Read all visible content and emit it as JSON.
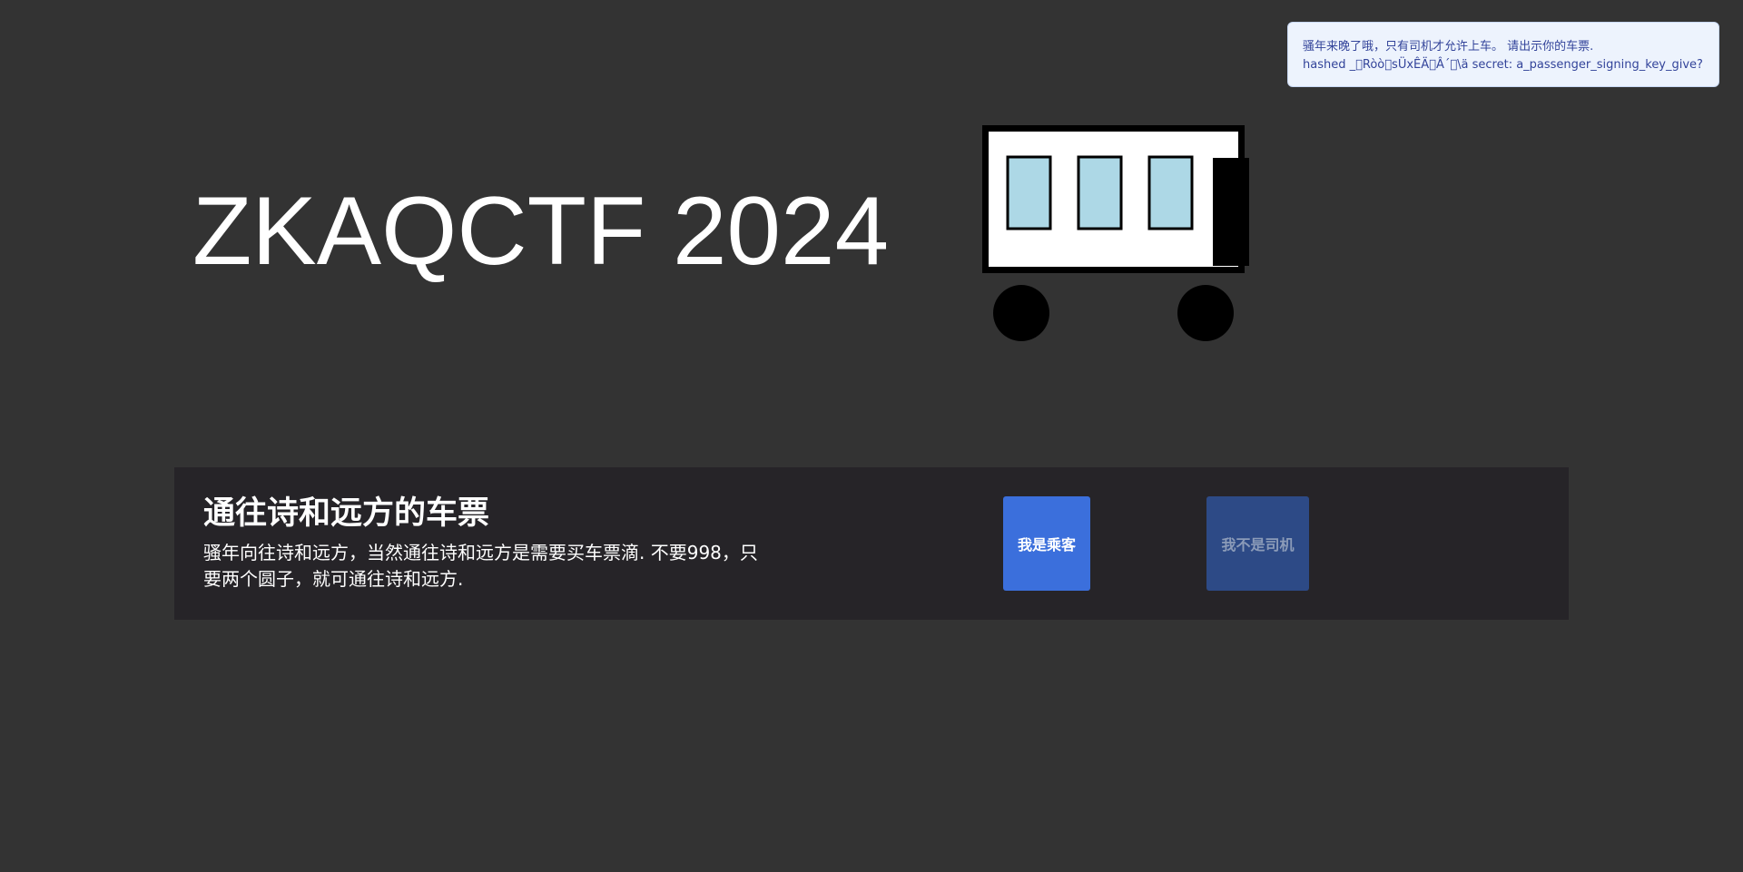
{
  "toast": {
    "line1": "骚年来晚了哦，只有司机才允许上车。 请出示你的车票.",
    "line2": "hashed _\u0000Ròò\u0000sÜxÊÄ\u0000Â´\u0000\\ä secret: a_passenger_signing_key_give?"
  },
  "header": {
    "title": "ZKAQCTF 2024"
  },
  "ticket": {
    "heading": "通往诗和远方的车票",
    "description": "骚年向往诗和远方，当然通往诗和远方是需要买车票滴. 不要998，只要两个圆子，就可通往诗和远方."
  },
  "buttons": {
    "passenger_label": "我是乘客",
    "not_driver_label": "我不是司机"
  },
  "colors": {
    "background": "#333333",
    "panel": "#262428",
    "primary_button": "#3b6fdc",
    "secondary_button": "#2d4a86",
    "window_glass": "#add8e6"
  }
}
